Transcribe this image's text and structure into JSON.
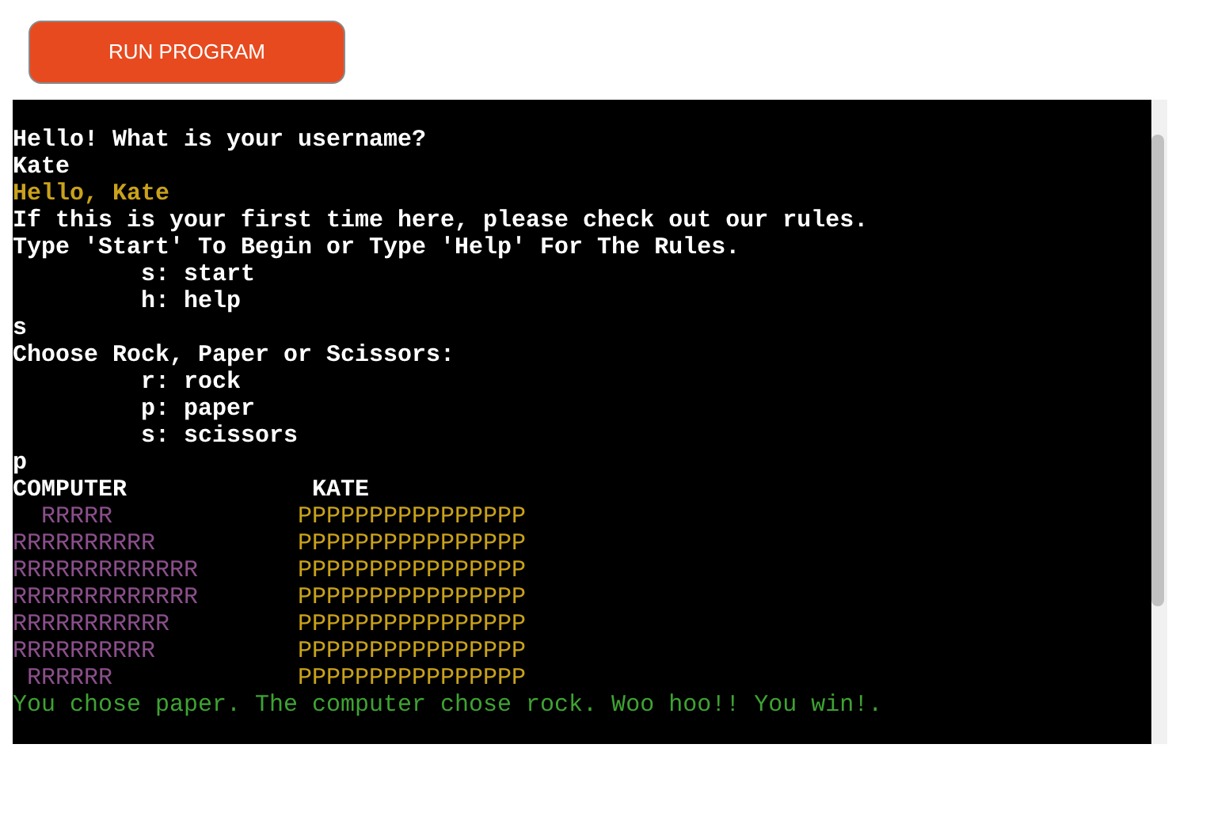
{
  "run_button": {
    "label": "RUN PROGRAM"
  },
  "terminal": {
    "lines": [
      {
        "kind": "prompt",
        "text": "Hello! What is your username?"
      },
      {
        "kind": "input",
        "text": "Kate"
      },
      {
        "kind": "greeting",
        "text": "Hello, Kate"
      },
      {
        "kind": "prompt",
        "text": "If this is your first time here, please check out our rules."
      },
      {
        "kind": "prompt",
        "text": "Type 'Start' To Begin or Type 'Help' For The Rules."
      },
      {
        "kind": "prompt",
        "text": "         s: start"
      },
      {
        "kind": "prompt",
        "text": "         h: help"
      },
      {
        "kind": "input",
        "text": "s"
      },
      {
        "kind": "prompt",
        "text": "Choose Rock, Paper or Scissors:"
      },
      {
        "kind": "prompt",
        "text": "         r: rock"
      },
      {
        "kind": "prompt",
        "text": "         p: paper"
      },
      {
        "kind": "prompt",
        "text": "         s: scissors"
      },
      {
        "kind": "input",
        "text": "p"
      }
    ],
    "board": {
      "computer_label": "COMPUTER",
      "player_label": "KATE",
      "rows": [
        {
          "computer": "  RRRRR",
          "player": "PPPPPPPPPPPPPPPP"
        },
        {
          "computer": "RRRRRRRRRR",
          "player": "PPPPPPPPPPPPPPPP"
        },
        {
          "computer": "RRRRRRRRRRRRR",
          "player": "PPPPPPPPPPPPPPPP"
        },
        {
          "computer": "RRRRRRRRRRRRR",
          "player": "PPPPPPPPPPPPPPPP"
        },
        {
          "computer": "RRRRRRRRRRR",
          "player": "PPPPPPPPPPPPPPPP"
        },
        {
          "computer": "RRRRRRRRRR",
          "player": "PPPPPPPPPPPPPPPP"
        },
        {
          "computer": " RRRRRR",
          "player": "PPPPPPPPPPPPPPPP"
        }
      ]
    },
    "result": "You chose paper. The computer chose rock. Woo hoo!! You win!."
  }
}
